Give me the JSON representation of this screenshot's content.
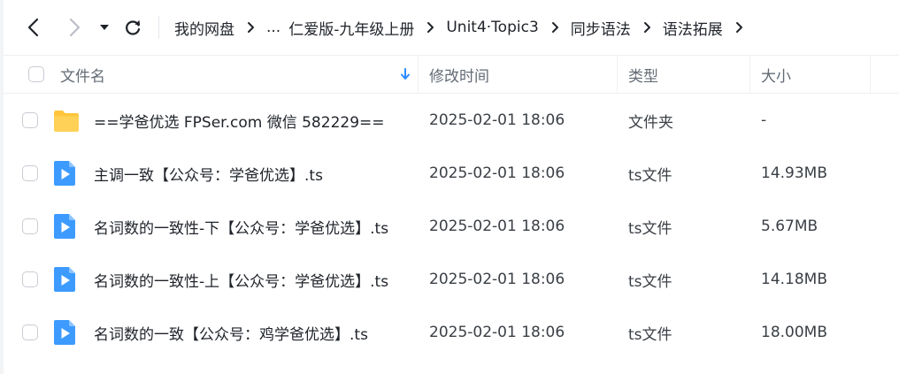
{
  "toolbar": {
    "breadcrumb": [
      "我的网盘",
      "...",
      "仁爱版-九年级上册",
      "Unit4·Topic3",
      "同步语法",
      "语法拓展"
    ]
  },
  "header": {
    "name": "文件名",
    "modified": "修改时间",
    "type": "类型",
    "size": "大小"
  },
  "files": [
    {
      "name": "==学爸优选 FPSer.com 微信 582229==",
      "modified": "2025-02-01 18:06",
      "type": "文件夹",
      "size": "-",
      "icon": "folder-icon"
    },
    {
      "name": "主调一致【公众号：学爸优选】.ts",
      "modified": "2025-02-01 18:06",
      "type": "ts文件",
      "size": "14.93MB",
      "icon": "video-file-icon"
    },
    {
      "name": "名词数的一致性-下【公众号：学爸优选】.ts",
      "modified": "2025-02-01 18:06",
      "type": "ts文件",
      "size": "5.67MB",
      "icon": "video-file-icon"
    },
    {
      "name": "名词数的一致性-上【公众号：学爸优选】.ts",
      "modified": "2025-02-01 18:06",
      "type": "ts文件",
      "size": "14.18MB",
      "icon": "video-file-icon"
    },
    {
      "name": "名词数的一致【公众号：鸡学爸优选】.ts",
      "modified": "2025-02-01 18:06",
      "type": "ts文件",
      "size": "18.00MB",
      "icon": "video-file-icon"
    }
  ],
  "colors": {
    "accent": "#2b8cff",
    "folder": "#ffc63d",
    "video_icon": "#3d9bff"
  }
}
